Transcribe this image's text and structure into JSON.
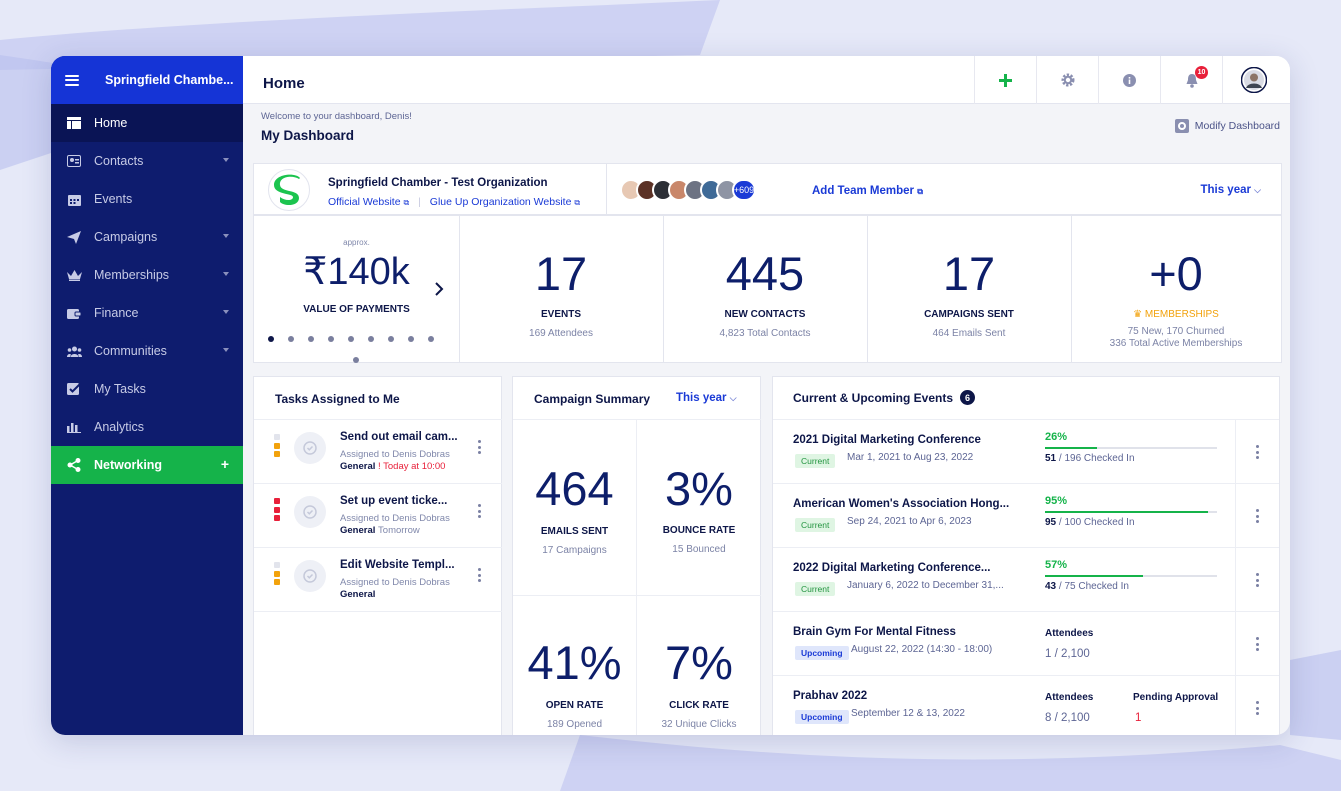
{
  "colors": {
    "brand_blue": "#1534d6",
    "sidebar_bg": "#0e1c6e",
    "accent_green": "#15b34a",
    "danger_red": "#e8203a",
    "priority_orange": "#f2a20c"
  },
  "sidebar": {
    "org_name": "Springfield Chambe...",
    "items": [
      {
        "label": "Home",
        "icon": "home-icon",
        "active": true
      },
      {
        "label": "Contacts",
        "icon": "contacts-icon",
        "has_caret": true
      },
      {
        "label": "Events",
        "icon": "calendar-icon"
      },
      {
        "label": "Campaigns",
        "icon": "paper-plane-icon",
        "has_caret": true
      },
      {
        "label": "Memberships",
        "icon": "crown-icon",
        "has_caret": true
      },
      {
        "label": "Finance",
        "icon": "wallet-icon",
        "has_caret": true
      },
      {
        "label": "Communities",
        "icon": "people-icon",
        "has_caret": true
      },
      {
        "label": "My Tasks",
        "icon": "checklist-icon"
      },
      {
        "label": "Analytics",
        "icon": "bar-chart-icon"
      },
      {
        "label": "Networking",
        "icon": "share-icon",
        "plus": "+"
      }
    ]
  },
  "topbar": {
    "title": "Home",
    "notification_count": "10"
  },
  "dashboard": {
    "welcome": "Welcome to your dashboard, Denis!",
    "title": "My Dashboard",
    "modify_label": "Modify Dashboard"
  },
  "org": {
    "name": "Springfield Chamber - Test Organization",
    "link1": "Official Website",
    "link2": "Glue Up Organization Website",
    "more_members": "+609",
    "add_team": "Add Team Member",
    "period": "This year"
  },
  "stats": {
    "payments": {
      "approx": "approx.",
      "value": "₹140k",
      "label": "VALUE OF PAYMENTS"
    },
    "events": {
      "value": "17",
      "label": "EVENTS",
      "sub": "169 Attendees"
    },
    "contacts": {
      "value": "445",
      "label": "NEW CONTACTS",
      "sub": "4,823 Total Contacts"
    },
    "campaigns": {
      "value": "17",
      "label": "CAMPAIGNS SENT",
      "sub": "464 Emails Sent"
    },
    "memberships": {
      "value": "+0",
      "label": "MEMBERSHIPS",
      "sub1": "75 New, 170 Churned",
      "sub2": "336 Total Active Memberships"
    }
  },
  "tasks": {
    "title": "Tasks Assigned to Me",
    "items": [
      {
        "name": "Send out email cam...",
        "assigned": "Assigned to Denis Dobras",
        "category": "General",
        "due": "! Today at 10:00",
        "priority_marks": 2
      },
      {
        "name": "Set up event ticke...",
        "assigned": "Assigned to Denis Dobras",
        "category": "General",
        "due": "Tomorrow",
        "priority_marks": 3
      },
      {
        "name": "Edit Website Templ...",
        "assigned": "Assigned to Denis Dobras",
        "category": "General",
        "due": "",
        "priority_marks": 2
      }
    ]
  },
  "campaign_summary": {
    "title": "Campaign Summary",
    "period": "This year",
    "cells": [
      {
        "value": "464",
        "label": "EMAILS SENT",
        "sub": "17 Campaigns"
      },
      {
        "value": "3%",
        "label": "BOUNCE RATE",
        "sub": "15 Bounced"
      },
      {
        "value": "41%",
        "label": "OPEN RATE",
        "sub": "189 Opened"
      },
      {
        "value": "7%",
        "label": "CLICK RATE",
        "sub": "32 Unique Clicks"
      }
    ]
  },
  "events_panel": {
    "title": "Current & Upcoming Events",
    "count": "6",
    "items": [
      {
        "name": "2021 Digital Marketing Conference",
        "status": "Current",
        "dates": "Mar 1, 2021 to Aug 23, 2022",
        "percent": "26%",
        "fill": 0.3,
        "checked": "51",
        "checked_total": "/ 196 Checked In"
      },
      {
        "name": "American Women's Association Hong...",
        "status": "Current",
        "dates": "Sep 24, 2021 to Apr 6, 2023",
        "percent": "95%",
        "fill": 0.95,
        "checked": "95",
        "checked_total": "/ 100 Checked In"
      },
      {
        "name": "2022 Digital Marketing Conference...",
        "status": "Current",
        "dates": "January 6, 2022 to December 31,...",
        "percent": "57%",
        "fill": 0.57,
        "checked": "43",
        "checked_total": "/ 75 Checked In"
      },
      {
        "name": "Brain Gym For Mental Fitness",
        "status": "Upcoming",
        "dates": "August 22, 2022 (14:30 - 18:00)",
        "attendees_label": "Attendees",
        "attendees": "1 / 2,100"
      },
      {
        "name": "Prabhav 2022",
        "status": "Upcoming",
        "dates": "September 12 & 13, 2022",
        "attendees_label": "Attendees",
        "attendees": "8 / 2,100",
        "pending_label": "Pending Approval",
        "pending": "1"
      }
    ]
  }
}
